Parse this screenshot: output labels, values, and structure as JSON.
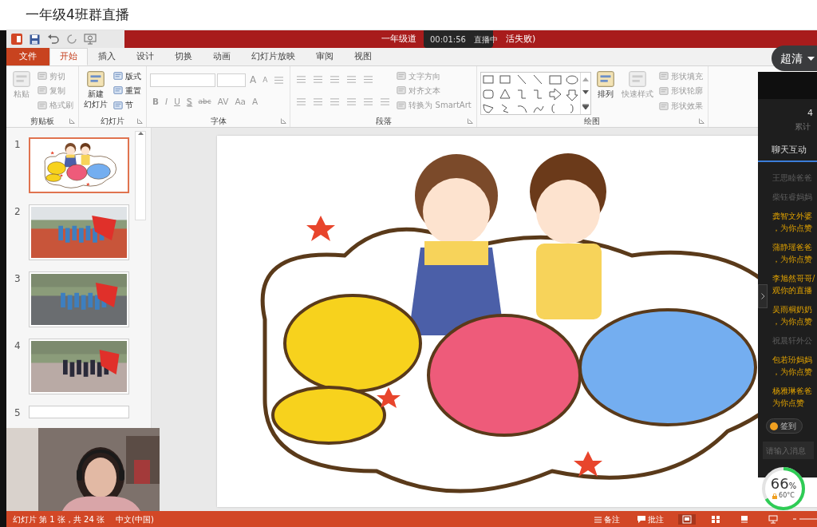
{
  "app_header": {
    "title": "一年级4班群直播"
  },
  "title_bar": {
    "title_start": "一年级道",
    "title_end": "活失败)"
  },
  "live_badge": {
    "time": "00:01:56",
    "status": "直播中"
  },
  "quality_button": {
    "label": "超清"
  },
  "ribbon_tabs": [
    {
      "label": "文件",
      "kind": "file",
      "selected": false
    },
    {
      "label": "开始",
      "kind": "tab",
      "selected": true
    },
    {
      "label": "插入",
      "kind": "tab",
      "selected": false
    },
    {
      "label": "设计",
      "kind": "tab",
      "selected": false
    },
    {
      "label": "切换",
      "kind": "tab",
      "selected": false
    },
    {
      "label": "动画",
      "kind": "tab",
      "selected": false
    },
    {
      "label": "幻灯片放映",
      "kind": "tab",
      "selected": false
    },
    {
      "label": "审阅",
      "kind": "tab",
      "selected": false
    },
    {
      "label": "视图",
      "kind": "tab",
      "selected": false
    }
  ],
  "ribbon_groups": [
    {
      "label": "剪贴板",
      "blocks": [
        {
          "kind": "large",
          "lines": [
            "粘贴"
          ],
          "disabled": true
        },
        {
          "kind": "stack",
          "rows": [
            {
              "items": [
                {
                  "kind": "small",
                  "label": "剪切",
                  "disabled": true
                }
              ]
            },
            {
              "items": [
                {
                  "kind": "small",
                  "label": "复制",
                  "disabled": true
                }
              ]
            },
            {
              "items": [
                {
                  "kind": "small",
                  "label": "格式刷",
                  "disabled": true
                }
              ]
            }
          ]
        }
      ]
    },
    {
      "label": "幻灯片",
      "blocks": [
        {
          "kind": "large",
          "lines": [
            "新建",
            "幻灯片"
          ],
          "disabled": false
        },
        {
          "kind": "stack",
          "rows": [
            {
              "items": [
                {
                  "kind": "small",
                  "label": "版式",
                  "disabled": false
                }
              ]
            },
            {
              "items": [
                {
                  "kind": "small",
                  "label": "重置",
                  "disabled": false
                }
              ]
            },
            {
              "items": [
                {
                  "kind": "small",
                  "label": "节",
                  "disabled": false
                }
              ]
            }
          ]
        }
      ]
    },
    {
      "label": "字体",
      "blocks": [
        {
          "kind": "stack",
          "rows": [
            {
              "items": [
                {
                  "kind": "field"
                },
                {
                  "kind": "field"
                },
                {
                  "kind": "glyph",
                  "label": "A",
                  "disabled": true
                },
                {
                  "kind": "glyph",
                  "label": "A",
                  "disabled": true
                },
                {
                  "kind": "tool",
                  "disabled": true
                }
              ]
            },
            {
              "items": [
                {
                  "kind": "glyph",
                  "label": "B",
                  "disabled": true
                },
                {
                  "kind": "glyph",
                  "label": "I",
                  "disabled": true
                },
                {
                  "kind": "glyph",
                  "label": "U",
                  "disabled": true
                },
                {
                  "kind": "glyph",
                  "label": "S",
                  "disabled": true
                },
                {
                  "kind": "glyph",
                  "label": "abc",
                  "disabled": true
                },
                {
                  "kind": "glyph",
                  "label": "AV",
                  "disabled": true
                },
                {
                  "kind": "glyph",
                  "label": "Aa",
                  "disabled": true
                },
                {
                  "kind": "glyph",
                  "label": "A",
                  "disabled": true
                }
              ]
            }
          ]
        }
      ]
    },
    {
      "label": "段落",
      "blocks": [
        {
          "kind": "stack",
          "rows": [
            {
              "items": [
                {
                  "kind": "tool",
                  "disabled": true
                },
                {
                  "kind": "tool",
                  "disabled": true
                },
                {
                  "kind": "tool",
                  "disabled": true
                },
                {
                  "kind": "tool",
                  "disabled": true
                },
                {
                  "kind": "tool",
                  "disabled": true
                }
              ]
            },
            {
              "items": [
                {
                  "kind": "tool",
                  "disabled": true
                },
                {
                  "kind": "tool",
                  "disabled": true
                },
                {
                  "kind": "tool",
                  "disabled": true
                },
                {
                  "kind": "tool",
                  "disabled": true
                },
                {
                  "kind": "tool",
                  "disabled": true
                },
                {
                  "kind": "tool",
                  "disabled": true
                }
              ]
            }
          ]
        },
        {
          "kind": "stack",
          "rows": [
            {
              "items": [
                {
                  "kind": "small",
                  "label": "文字方向",
                  "disabled": true
                }
              ]
            },
            {
              "items": [
                {
                  "kind": "small",
                  "label": "对齐文本",
                  "disabled": true
                }
              ]
            },
            {
              "items": [
                {
                  "kind": "small",
                  "label": "转换为 SmartArt",
                  "disabled": true
                }
              ]
            }
          ]
        }
      ]
    },
    {
      "label": "绘图",
      "blocks": [
        {
          "kind": "gallery",
          "disabled": false
        },
        {
          "kind": "large",
          "lines": [
            "排列"
          ],
          "disabled": false
        },
        {
          "kind": "large",
          "lines": [
            "快速样式"
          ],
          "disabled": true
        },
        {
          "kind": "stack",
          "rows": [
            {
              "items": [
                {
                  "kind": "small",
                  "label": "形状填充",
                  "disabled": true
                }
              ]
            },
            {
              "items": [
                {
                  "kind": "small",
                  "label": "形状轮廓",
                  "disabled": true
                }
              ]
            },
            {
              "items": [
                {
                  "kind": "small",
                  "label": "形状效果",
                  "disabled": true
                }
              ]
            }
          ]
        }
      ]
    }
  ],
  "thumbnails": [
    {
      "number": "1",
      "kind": "title",
      "selected": true
    },
    {
      "number": "2",
      "selected": false
    },
    {
      "number": "3",
      "selected": false
    },
    {
      "number": "4",
      "selected": false
    },
    {
      "number": "5",
      "kind": "blank",
      "selected": false
    }
  ],
  "chat_panel": {
    "viewers_count": "4",
    "viewers_label": "累计",
    "tab": "聊天互动",
    "messages": [
      {
        "kind": "system",
        "lines": [
          "王思睦爸爸"
        ]
      },
      {
        "kind": "system",
        "lines": [
          "柴钰睿妈妈"
        ]
      },
      {
        "kind": "like",
        "lines": [
          "龚智文外婆",
          "，为你点赞"
        ]
      },
      {
        "kind": "like",
        "lines": [
          "蒲静瑶爸爸",
          "，为你点赞"
        ]
      },
      {
        "kind": "like",
        "lines": [
          "李旭然哥哥/",
          "观你的直播"
        ]
      },
      {
        "kind": "like",
        "lines": [
          "吴雨桐奶奶",
          "，为你点赞"
        ]
      },
      {
        "kind": "system",
        "lines": [
          "祝晨轩外公"
        ]
      },
      {
        "kind": "like",
        "lines": [
          "包若玢妈妈",
          "，为你点赞"
        ]
      },
      {
        "kind": "like",
        "lines": [
          "杨雅琳爸爸",
          "为你点赞"
        ]
      }
    ],
    "checkin_button": "签到",
    "input_placeholder": "请输入消息"
  },
  "performance_badge": {
    "value": "66",
    "unit": "%",
    "temperature": "60°C"
  },
  "status_bar": {
    "slide_info": "幻灯片 第 1 张，共 24 张",
    "language": "中文(中国)",
    "notes": "备注",
    "comments": "批注",
    "views": [
      {
        "selected": true
      },
      {
        "selected": false
      },
      {
        "selected": false
      },
      {
        "selected": false
      }
    ]
  }
}
